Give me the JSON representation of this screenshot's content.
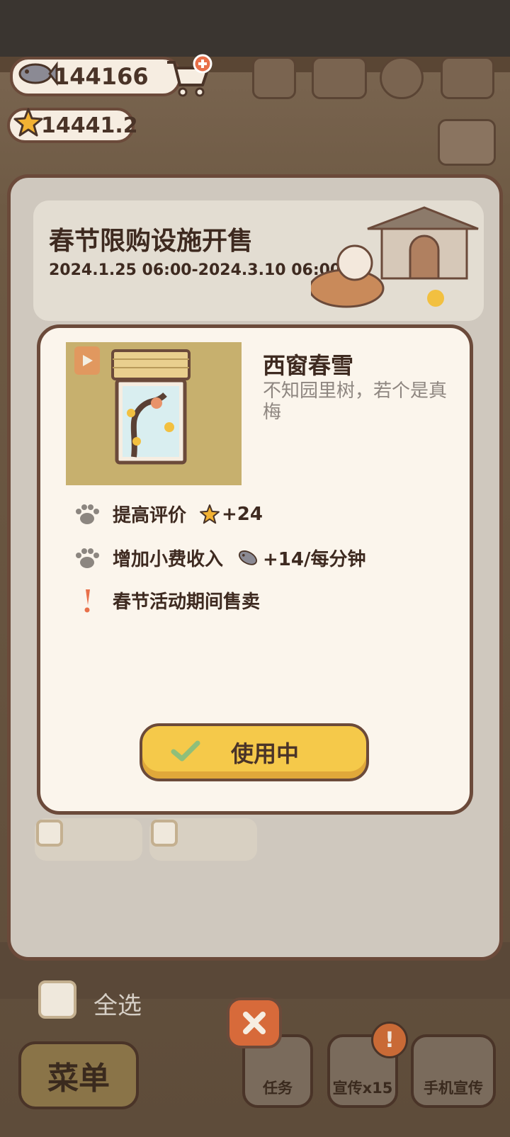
{
  "hud": {
    "fish_currency": "144166",
    "star_rating": "14441.2"
  },
  "banner": {
    "title": "春节限购设施开售",
    "dates": "2024.1.25 06:00-2024.3.10 06:00"
  },
  "item": {
    "name": "西窗春雪",
    "description": "不知园里树，若个是真梅",
    "attributes": [
      {
        "label": "提高评价",
        "value": "+24",
        "icon": "star-icon"
      },
      {
        "label": "增加小费收入",
        "value": "+14/每分钟",
        "icon": "fish-icon"
      },
      {
        "label": "春节活动期间售卖",
        "value": "",
        "icon": "exclamation-icon"
      }
    ],
    "button_label": "使用中"
  },
  "bottom": {
    "select_all": "全选",
    "menu": "菜单",
    "tasks": "任务",
    "promote": "宣传x15",
    "phone_promote": "手机宣传",
    "badge": "!"
  },
  "colors": {
    "panel_border": "#6b4a3a",
    "modal_bg": "#fbf5ec",
    "button_yellow": "#f5c94a",
    "check_green": "#8fbf7a",
    "accent_red": "#e8704a"
  }
}
